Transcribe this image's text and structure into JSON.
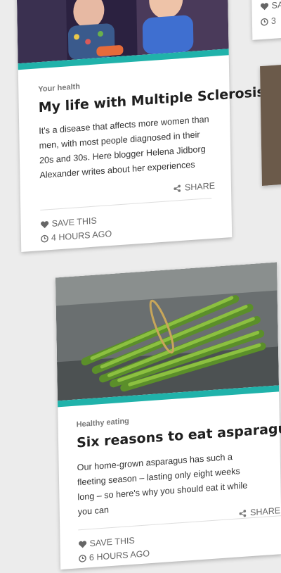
{
  "cards": [
    {
      "category": "Your health",
      "title": "My life with Multiple Sclerosis",
      "description_lines": [
        "It's a disease that affects more women than",
        "men, with most people diagnosed in their",
        "20s and 30s. Here blogger Helena Jidborg",
        "Alexander writes about her experiences"
      ],
      "share_label": "SHARE",
      "save_label": "SAVE THIS",
      "time_label": "4 HOURS AGO"
    },
    {
      "category": "Healthy eating",
      "title": "Six reasons to eat asparagus",
      "description_lines": [
        "Our home-grown asparagus has such a",
        "fleeting season – lasting only eight weeks",
        "long – so here's why you should eat it while",
        "you can"
      ],
      "share_label": "SHARE",
      "save_label": "SAVE THIS",
      "time_label": "6 HOURS AGO"
    }
  ],
  "side_card": {
    "save_fragment": "SA",
    "time_fragment": "3 "
  },
  "colors": {
    "accent": "#20b2aa",
    "page_background": "#ececec"
  }
}
